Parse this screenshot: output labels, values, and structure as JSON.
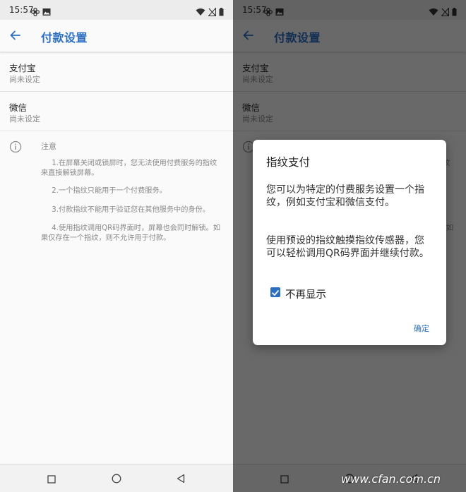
{
  "status_bar": {
    "time": "15:57"
  },
  "app_bar": {
    "title": "付款设置"
  },
  "settings": [
    {
      "title": "支付宝",
      "subtitle": "尚未设定"
    },
    {
      "title": "微信",
      "subtitle": "尚未设定"
    }
  ],
  "notes": {
    "title": "注意",
    "items": [
      "1.在屏幕关闭或锁屏时，您无法使用付费服务的指纹来直接解锁屏幕。",
      "2.一个指纹只能用于一个付费服务。",
      "3.付款指纹不能用于验证您在其他服务中的身份。",
      "4.使用指纹调用QR码界面时，屏幕也会同时解锁。如果仅存在一个指纹，则不允许用于付款。"
    ]
  },
  "dialog": {
    "title": "指纹支付",
    "paragraph1": "您可以为特定的付费服务设置一个指纹，例如支付宝和微信支付。",
    "paragraph2": "使用预设的指纹触摸指纹传感器，您可以轻松调用QR码界面并继续付款。",
    "checkbox_label": "不再显示",
    "checkbox_checked": true,
    "confirm_label": "确定"
  },
  "watermark": "www.cfan.com.cn",
  "colors": {
    "accent": "#2a6fc4",
    "scrim": "rgba(0,0,0,0.58)"
  }
}
